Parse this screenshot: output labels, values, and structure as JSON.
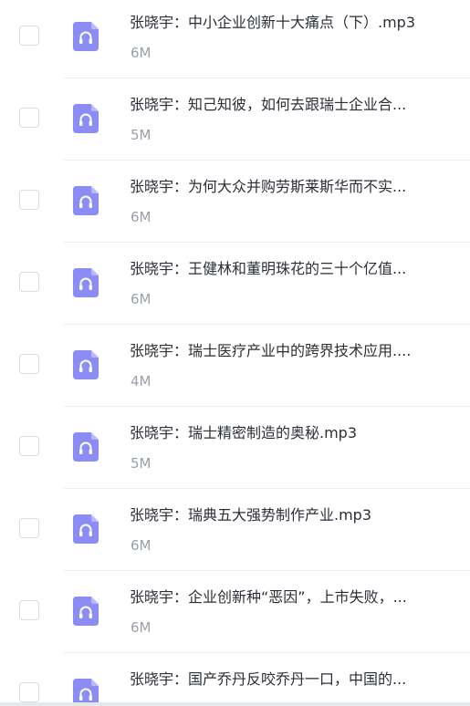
{
  "files": [
    {
      "name": "张晓宇：中小企业创新十大痛点（下）.mp3",
      "size": "6M",
      "icon": "headphones-icon"
    },
    {
      "name": "张晓宇：知己知彼，如何去跟瑞士企业合...",
      "size": "5M",
      "icon": "headphones-icon"
    },
    {
      "name": "张晓宇：为何大众并购劳斯莱斯华而不实...",
      "size": "6M",
      "icon": "headphones-icon"
    },
    {
      "name": "张晓宇：王健林和董明珠花的三十个亿值...",
      "size": "6M",
      "icon": "headphones-icon"
    },
    {
      "name": "张晓宇：瑞士医疗产业中的跨界技术应用....",
      "size": "4M",
      "icon": "headphones-icon"
    },
    {
      "name": "张晓宇：瑞士精密制造的奥秘.mp3",
      "size": "5M",
      "icon": "headphones-icon"
    },
    {
      "name": "张晓宇：瑞典五大强势制作产业.mp3",
      "size": "6M",
      "icon": "headphones-icon"
    },
    {
      "name": "张晓宇：企业创新种“恶因”，上市失败，...",
      "size": "6M",
      "icon": "headphones-icon"
    },
    {
      "name": "张晓宇：国产乔丹反咬乔丹一口，中国的...",
      "size": "",
      "icon": "headphones-icon"
    }
  ],
  "colors": {
    "icon_bg": "#8c8cf5",
    "icon_fold": "#b9b9fb",
    "text_primary": "#2b2f36",
    "text_secondary": "#9aa0aa"
  }
}
